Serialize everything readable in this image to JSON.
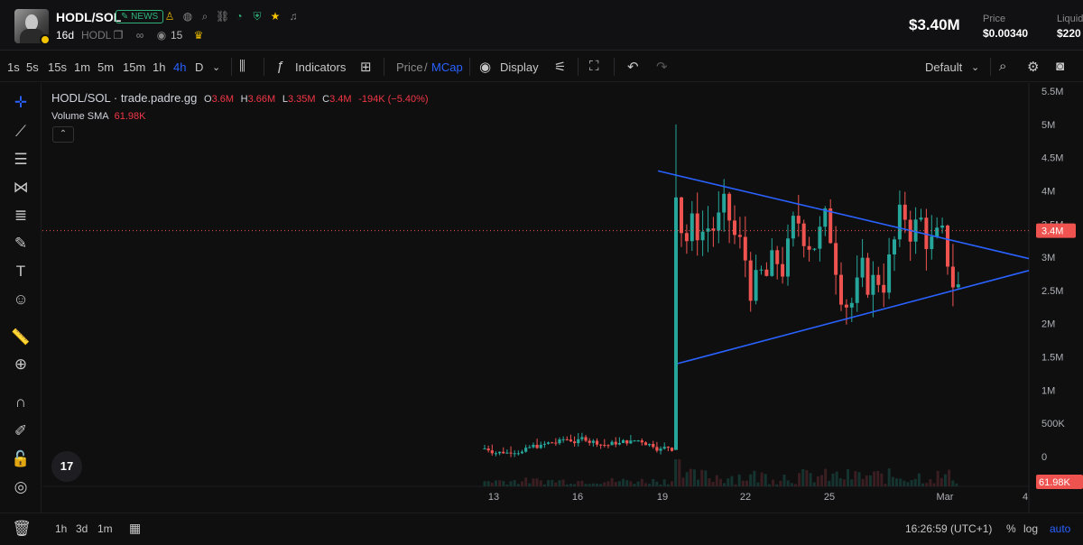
{
  "header": {
    "pair": "HODL/SOL",
    "news_badge": "NEWS",
    "age": "16d",
    "ticker": "HODL",
    "views": "15",
    "market_cap": "$3.40M",
    "price_label": "Price",
    "price_value": "$0.00340",
    "liquidity_label": "Liquid",
    "liquidity_value": "$220"
  },
  "toolbar": {
    "timeframes": [
      "1s",
      "5s",
      "15s",
      "1m",
      "5m",
      "15m",
      "1h",
      "4h",
      "D"
    ],
    "active_timeframe": "4h",
    "indicators_label": "Indicators",
    "price_label": "Price",
    "slash": "/",
    "mcap_label": "MCap",
    "display_label": "Display",
    "layout_label": "Default"
  },
  "legend": {
    "symbol": "HODL/SOL · trade.padre.gg",
    "o_key": "O",
    "o_val": "3.6M",
    "h_key": "H",
    "h_val": "3.66M",
    "l_key": "L",
    "l_val": "3.35M",
    "c_key": "C",
    "c_val": "3.4M",
    "change": "-194K (−5.40%)",
    "volume_label": "Volume SMA",
    "volume_val": "61.98K"
  },
  "chart_data": {
    "type": "candlestick",
    "y_ticks": [
      "5.5M",
      "5M",
      "4.5M",
      "4M",
      "3.5M",
      "3M",
      "2.5M",
      "2M",
      "1.5M",
      "1M",
      "500K",
      "0"
    ],
    "ylim": [
      0,
      5.5
    ],
    "x_ticks": [
      "13",
      "16",
      "19",
      "22",
      "25",
      "Mar",
      "4"
    ],
    "current_price_label": "3.4M",
    "volume_sma_label": "61.98K",
    "colors": {
      "up": "#26a69a",
      "down": "#ef5350",
      "trendline": "#2962ff",
      "price_line": "#ef5350"
    },
    "trendlines": [
      {
        "from": [
          "19.0",
          4.3
        ],
        "to": [
          "4.0",
          2.98
        ]
      },
      {
        "from": [
          "19.0",
          1.4
        ],
        "to": [
          "4.0",
          2.8
        ]
      }
    ]
  },
  "bottom": {
    "ranges": [
      "1h",
      "3d",
      "1m"
    ],
    "time": "16:26:59 (UTC+1)",
    "pct": "%",
    "log": "log",
    "auto": "auto"
  },
  "tools": [
    "crosshair",
    "trend-line",
    "horizontal-lines",
    "pattern",
    "fib",
    "brush",
    "text",
    "emoji",
    "ruler",
    "zoom",
    "magnet",
    "lock-draw",
    "lock",
    "eye",
    "trash"
  ]
}
